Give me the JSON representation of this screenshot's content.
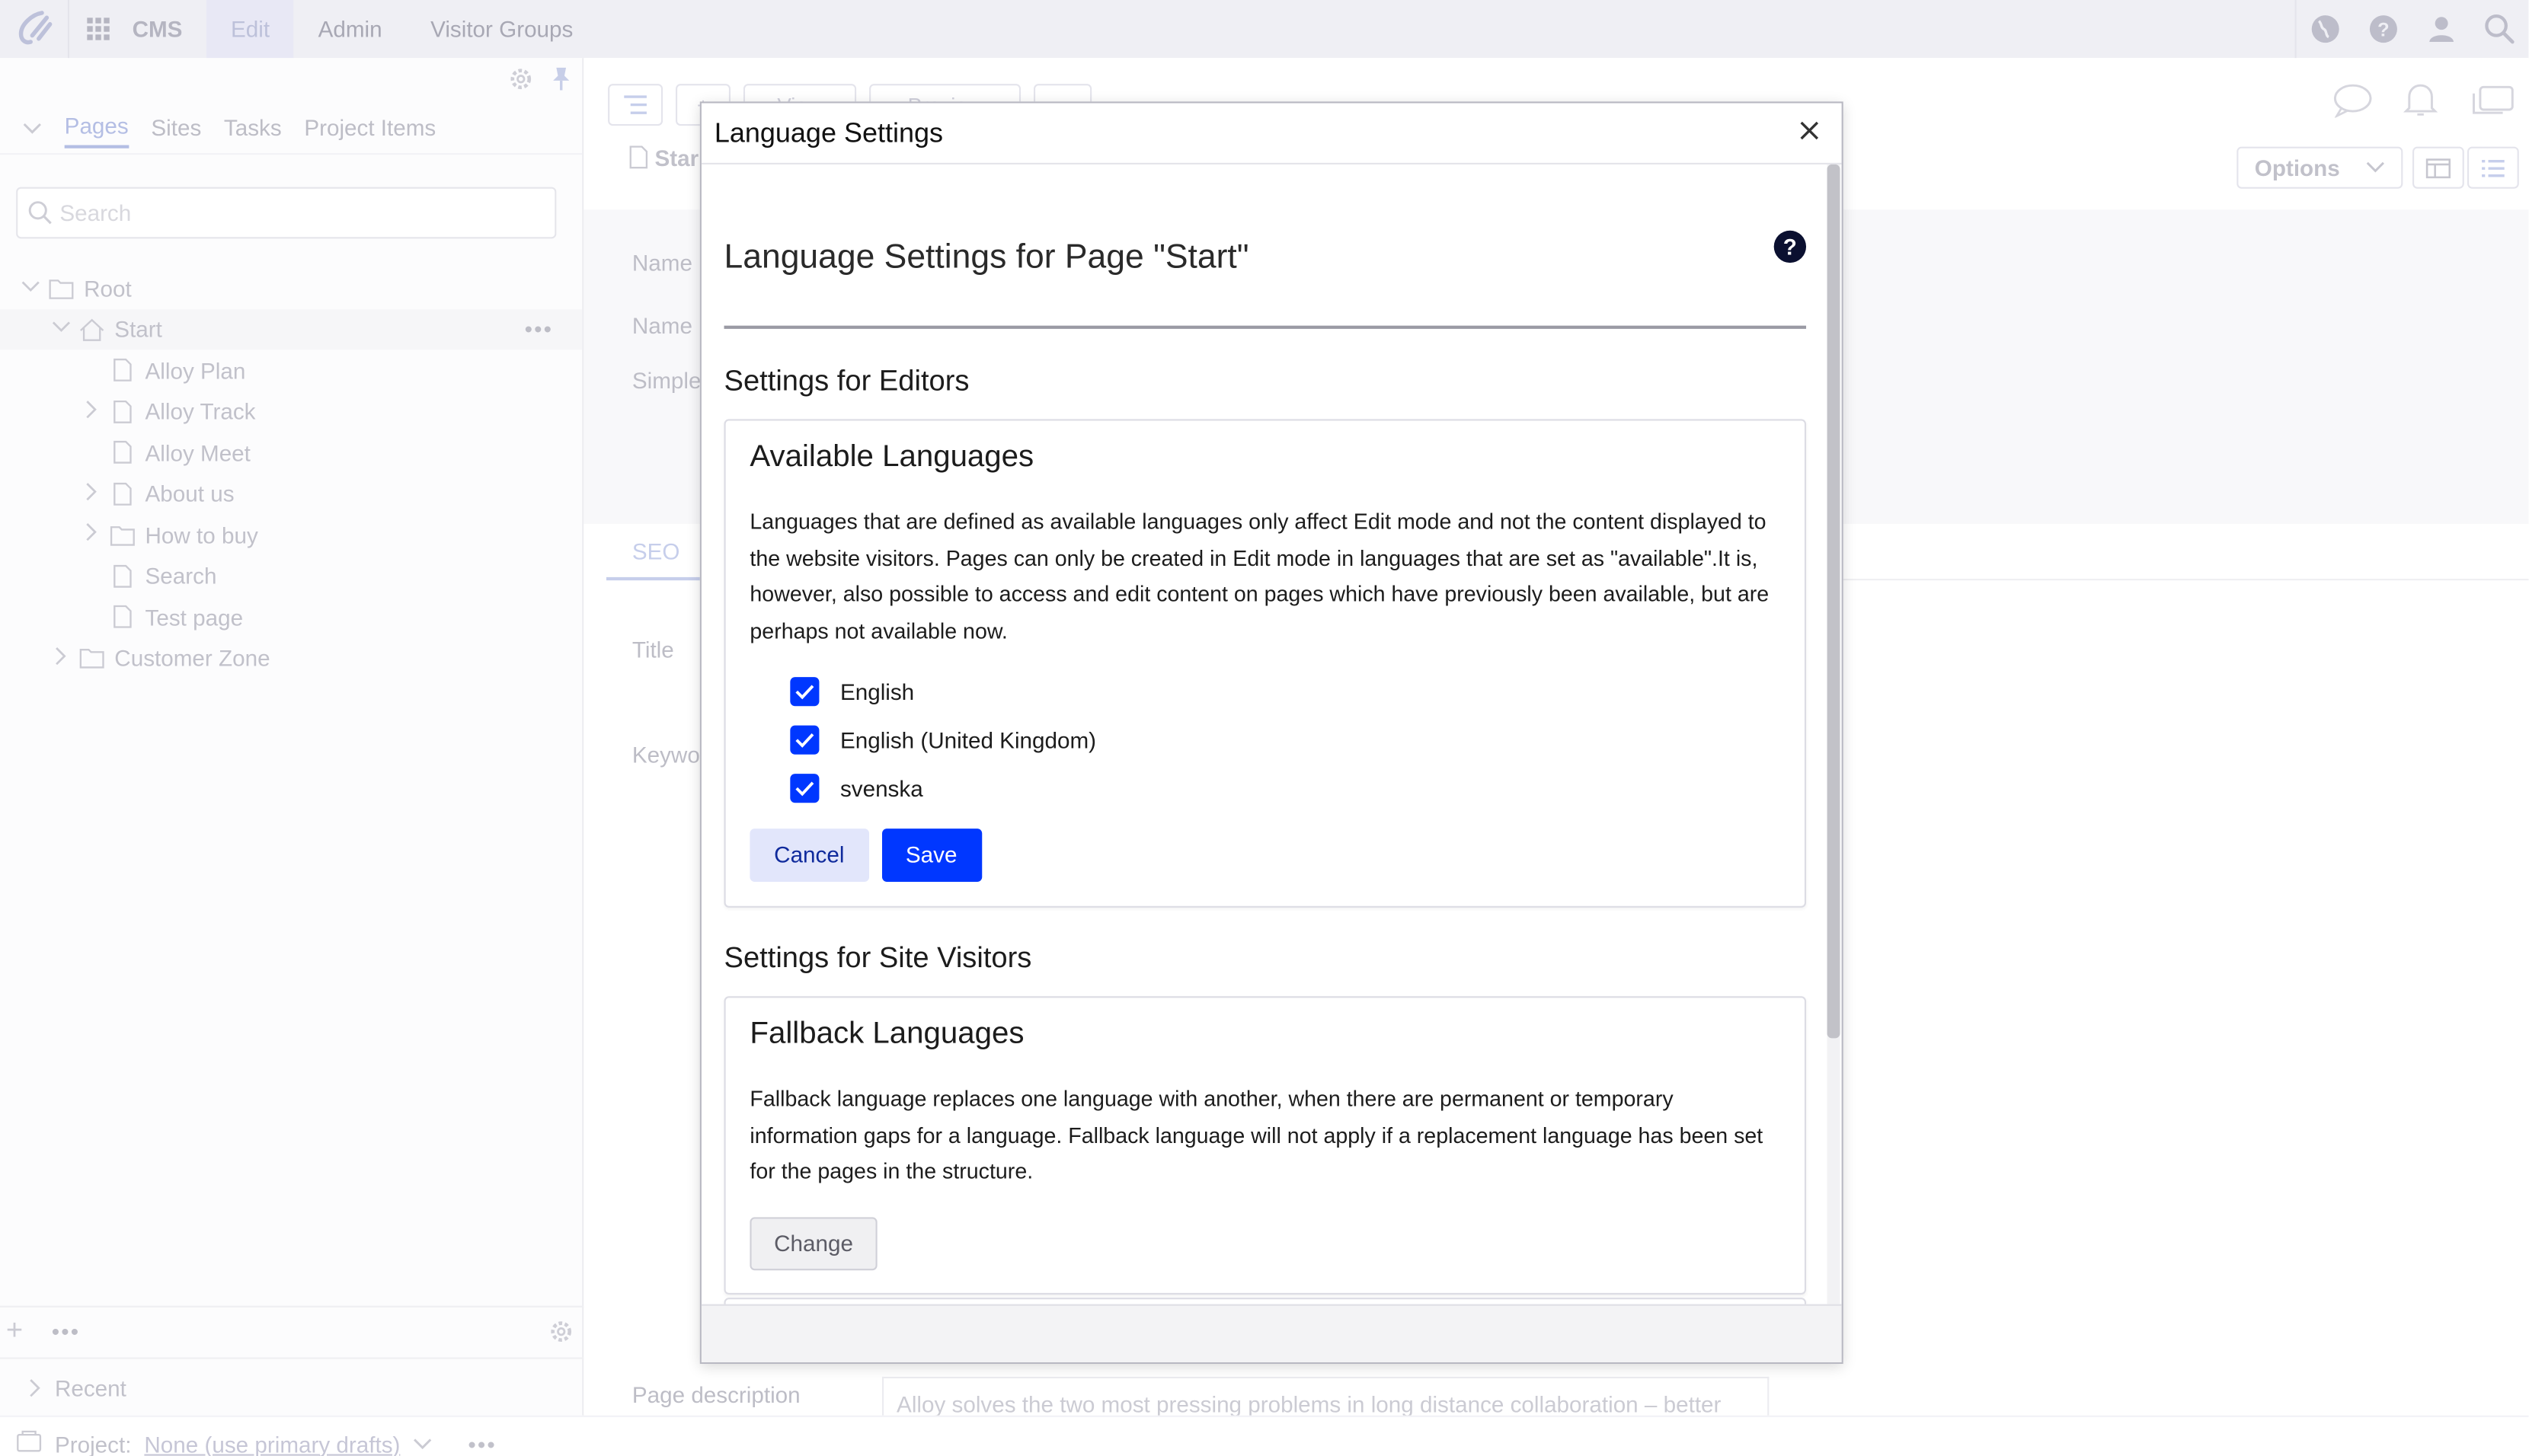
{
  "topbar": {
    "product": "CMS",
    "items": [
      "Edit",
      "Admin",
      "Visitor Groups"
    ],
    "active": "Edit"
  },
  "nav": {
    "tabs": [
      "Pages",
      "Sites",
      "Tasks",
      "Project Items"
    ],
    "active_tab": "Pages",
    "search_placeholder": "Search",
    "tree": [
      {
        "label": "Root",
        "level": 0,
        "expanded": true,
        "icon": "folder-icon"
      },
      {
        "label": "Start",
        "level": 1,
        "expanded": true,
        "icon": "home-icon",
        "selected": true
      },
      {
        "label": "Alloy Plan",
        "level": 2,
        "icon": "page-icon"
      },
      {
        "label": "Alloy Track",
        "level": 2,
        "icon": "page-icon",
        "has_children": true
      },
      {
        "label": "Alloy Meet",
        "level": 2,
        "icon": "page-icon"
      },
      {
        "label": "About us",
        "level": 2,
        "icon": "page-icon",
        "has_children": true
      },
      {
        "label": "How to buy",
        "level": 2,
        "icon": "folder-icon",
        "has_children": true
      },
      {
        "label": "Search",
        "level": 2,
        "icon": "page-icon"
      },
      {
        "label": "Test page",
        "level": 2,
        "icon": "page-icon"
      },
      {
        "label": "Customer Zone",
        "level": 1,
        "icon": "folder-icon",
        "has_children": true
      }
    ],
    "recent": "Recent"
  },
  "project": {
    "label": "Project:",
    "value": "None (use primary drafts)"
  },
  "editor": {
    "page_title": "Star",
    "options": "Options",
    "toolbar_partial": [
      "View",
      "Preview"
    ],
    "fields": [
      "Name",
      "Name i",
      "Simple"
    ],
    "tab_seo": "SEO",
    "seo_fields": [
      "Title",
      "Keywo"
    ],
    "page_description_label": "Page description",
    "page_description_value": "Alloy solves the two most pressing problems in long distance collaboration – better"
  },
  "dialog": {
    "title": "Language Settings",
    "heading": "Language Settings for Page \"Start\"",
    "editors_heading": "Settings for Editors",
    "available": {
      "title": "Available Languages",
      "description": "Languages that are defined as available languages only affect Edit mode and not the content displayed to the website visitors. Pages can only be created in Edit mode in languages that are set as \"available\".It is, however, also possible to access and edit content on pages which have previously been available, but are perhaps not available now.",
      "languages": [
        {
          "name": "English",
          "checked": true
        },
        {
          "name": "English (United Kingdom)",
          "checked": true
        },
        {
          "name": "svenska",
          "checked": true
        }
      ],
      "cancel": "Cancel",
      "save": "Save"
    },
    "visitors_heading": "Settings for Site Visitors",
    "fallback": {
      "title": "Fallback Languages",
      "description": "Fallback language replaces one language with another, when there are permanent or temporary information gaps for a language. Fallback language will not apply if a replacement language has been set for the pages in the structure.",
      "change": "Change"
    }
  },
  "colors": {
    "accent": "#0037ff",
    "topbar": "#e7e7ef"
  }
}
